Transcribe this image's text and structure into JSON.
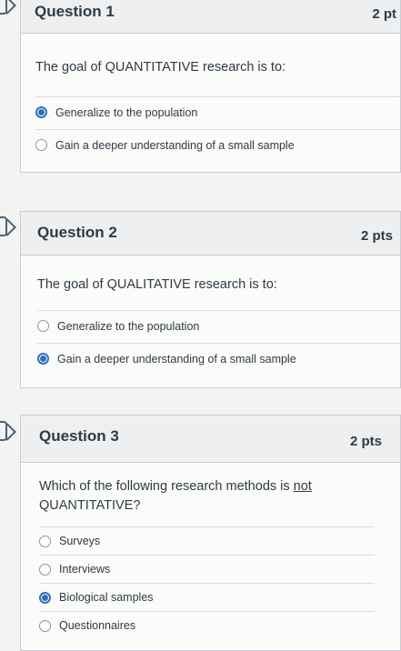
{
  "questions": [
    {
      "title": "Question 1",
      "points": "2 pt",
      "text": "The goal of QUANTITATIVE research is to:",
      "answers": [
        {
          "label": "Generalize to the population",
          "selected": true
        },
        {
          "label": "Gain a deeper understanding of a small sample",
          "selected": false
        }
      ]
    },
    {
      "title": "Question 2",
      "points": "2 pts",
      "text": "The goal of QUALITATIVE research is to:",
      "answers": [
        {
          "label": "Generalize to the population",
          "selected": false
        },
        {
          "label": "Gain a deeper understanding of a small sample",
          "selected": true
        }
      ]
    },
    {
      "title": "Question 3",
      "points": "2 pts",
      "text_before": "Which of the following research methods is ",
      "text_underlined": "not",
      "text_after": "QUANTITATIVE?",
      "answers": [
        {
          "label": "Surveys",
          "selected": false
        },
        {
          "label": "Interviews",
          "selected": false
        },
        {
          "label": "Biological samples",
          "selected": true
        },
        {
          "label": "Questionnaires",
          "selected": false
        }
      ]
    }
  ],
  "colors": {
    "accent": "#2f6fb8",
    "header_bg": "#eeeff0",
    "border": "#c7cdd1"
  }
}
